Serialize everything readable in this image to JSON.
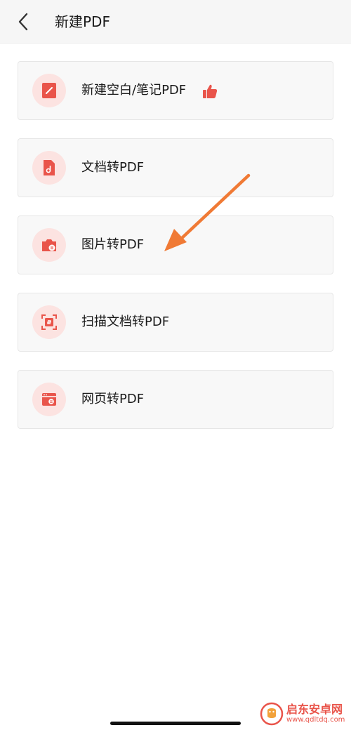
{
  "header": {
    "title": "新建PDF"
  },
  "menu": {
    "items": [
      {
        "label": "新建空白/笔记PDF",
        "icon": "new-note-icon",
        "recommended": true
      },
      {
        "label": "文档转PDF",
        "icon": "document-icon",
        "recommended": false
      },
      {
        "label": "图片转PDF",
        "icon": "image-icon",
        "recommended": false
      },
      {
        "label": "扫描文档转PDF",
        "icon": "scan-icon",
        "recommended": false
      },
      {
        "label": "网页转PDF",
        "icon": "webpage-icon",
        "recommended": false
      }
    ]
  },
  "annotation": {
    "arrow_color": "#f07a35",
    "points_to": "图片转PDF"
  },
  "watermark": {
    "brand": "启东安卓网",
    "url": "www.qdltdq.com"
  },
  "colors": {
    "accent": "#e9544a",
    "icon_bg": "#fce3e1"
  }
}
